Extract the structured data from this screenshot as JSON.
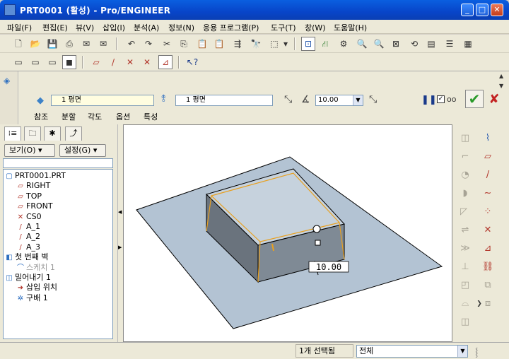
{
  "window": {
    "title": "PRT0001 (활성) - Pro/ENGINEER"
  },
  "menu": [
    "파일(F)",
    "편집(E)",
    "뷰(V)",
    "삽입(I)",
    "분석(A)",
    "정보(N)",
    "응용 프로그램(P)",
    "도구(T)",
    "창(W)",
    "도움말(H)"
  ],
  "dashboard": {
    "ref1": "1 평면",
    "ref2": "1 평면",
    "angle_value": "10.00",
    "tabs": [
      "참조",
      "분할",
      "각도",
      "옵션",
      "특성"
    ]
  },
  "panel": {
    "show_label": "보기(O) ▾",
    "settings_label": "설정(G) ▾",
    "tree": [
      {
        "icon": "part-icon",
        "glyph": "▢",
        "label": "PRT0001.PRT",
        "indent": 0,
        "color": "#000"
      },
      {
        "icon": "datum-plane-icon",
        "glyph": "▱",
        "label": "RIGHT",
        "indent": 1,
        "color": "#000"
      },
      {
        "icon": "datum-plane-icon",
        "glyph": "▱",
        "label": "TOP",
        "indent": 1,
        "color": "#000"
      },
      {
        "icon": "datum-plane-icon",
        "glyph": "▱",
        "label": "FRONT",
        "indent": 1,
        "color": "#000"
      },
      {
        "icon": "coord-sys-icon",
        "glyph": "✕",
        "label": "CS0",
        "indent": 1,
        "color": "#000"
      },
      {
        "icon": "axis-icon",
        "glyph": "/",
        "label": "A_1",
        "indent": 1,
        "color": "#000"
      },
      {
        "icon": "axis-icon",
        "glyph": "/",
        "label": "A_2",
        "indent": 1,
        "color": "#000"
      },
      {
        "icon": "axis-icon",
        "glyph": "/",
        "label": "A_3",
        "indent": 1,
        "color": "#000"
      },
      {
        "icon": "wall-icon",
        "glyph": "◧",
        "label": "첫 번째 벽",
        "indent": 0,
        "color": "#000"
      },
      {
        "icon": "sketch-icon",
        "glyph": "⌒",
        "label": "스케치 1",
        "indent": 1,
        "color": "#999"
      },
      {
        "icon": "extrude-icon",
        "glyph": "◫",
        "label": "밀어내기 1",
        "indent": 0,
        "color": "#000"
      },
      {
        "icon": "insert-here-icon",
        "glyph": "➜",
        "label": "삽입 위치",
        "indent": 1,
        "color": "#000"
      },
      {
        "icon": "bend-icon",
        "glyph": "✲",
        "label": "구배 1",
        "indent": 1,
        "color": "#000"
      }
    ]
  },
  "canvas": {
    "dimension_label": "10.00"
  },
  "status": {
    "selected": "1개 선택됨",
    "filter": "전체"
  }
}
